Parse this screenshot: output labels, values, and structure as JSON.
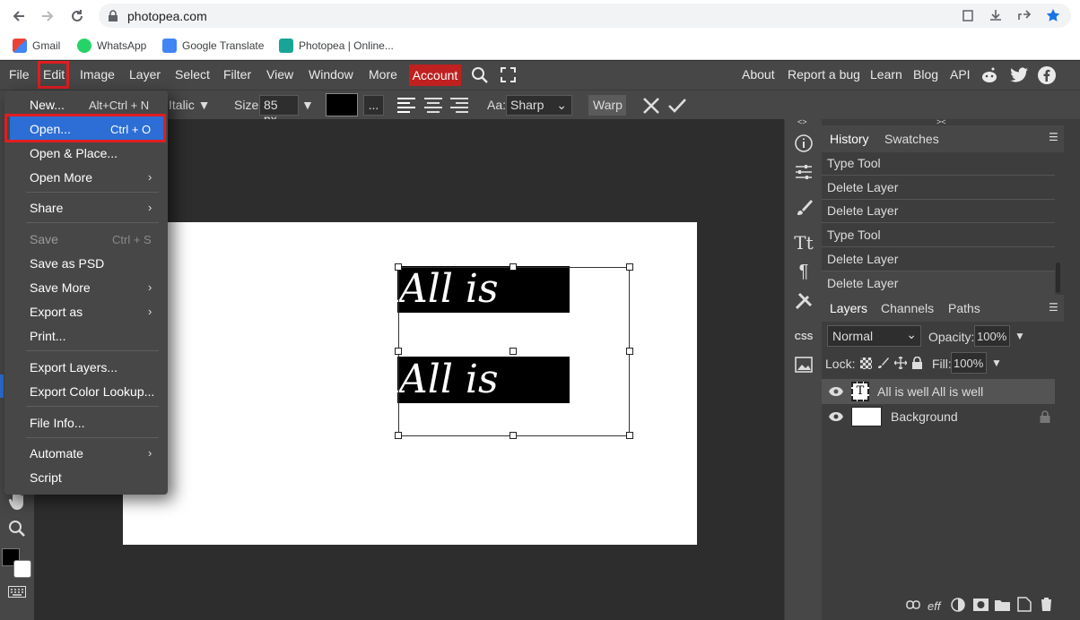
{
  "browser": {
    "url": "photopea.com",
    "bookmarks": [
      "Gmail",
      "WhatsApp",
      "Google Translate",
      "Photopea | Online..."
    ]
  },
  "menu": {
    "items": [
      "File",
      "Edit",
      "Image",
      "Layer",
      "Select",
      "Filter",
      "View",
      "Window",
      "More"
    ],
    "account": "Account",
    "right": [
      "About",
      "Report a bug",
      "Learn",
      "Blog",
      "API"
    ]
  },
  "options": {
    "style": "Italic",
    "size_label": "Size:",
    "size_value": "85 px",
    "more": "...",
    "aa_label": "Aa:",
    "aa_value": "Sharp",
    "warp": "Warp"
  },
  "canvas": {
    "text1": "All is well",
    "text2": "All is well"
  },
  "edit_menu": {
    "items": [
      {
        "label": "New...",
        "shortcut": "Alt+Ctrl + N"
      },
      {
        "label": "Open...",
        "shortcut": "Ctrl + O"
      },
      {
        "label": "Open & Place..."
      },
      {
        "label": "Open More"
      },
      {
        "label": "Share"
      },
      {
        "label": "Save",
        "shortcut": "Ctrl + S"
      },
      {
        "label": "Save as PSD"
      },
      {
        "label": "Save More"
      },
      {
        "label": "Export as"
      },
      {
        "label": "Print..."
      },
      {
        "label": "Export Layers..."
      },
      {
        "label": "Export Color Lookup..."
      },
      {
        "label": "File Info..."
      },
      {
        "label": "Automate"
      },
      {
        "label": "Script"
      }
    ]
  },
  "history": {
    "tabs": [
      "History",
      "Swatches"
    ],
    "rows": [
      "Type Tool",
      "Delete Layer",
      "Delete Layer",
      "Type Tool",
      "Delete Layer",
      "Delete Layer"
    ]
  },
  "layers": {
    "tabs": [
      "Layers",
      "Channels",
      "Paths"
    ],
    "blend": "Normal",
    "opacity_label": "Opacity:",
    "opacity": "100%",
    "lock_label": "Lock:",
    "fill_label": "Fill:",
    "fill": "100%",
    "rows": [
      "All is well All is well",
      "Background"
    ],
    "text_layer_icon": "T",
    "footer_fx": "eff"
  },
  "right_icons": {
    "css": "CSS"
  },
  "colors": {
    "account_bg": "#c0201f",
    "highlight": "#2c6ed5",
    "outline": "#e11d21"
  }
}
